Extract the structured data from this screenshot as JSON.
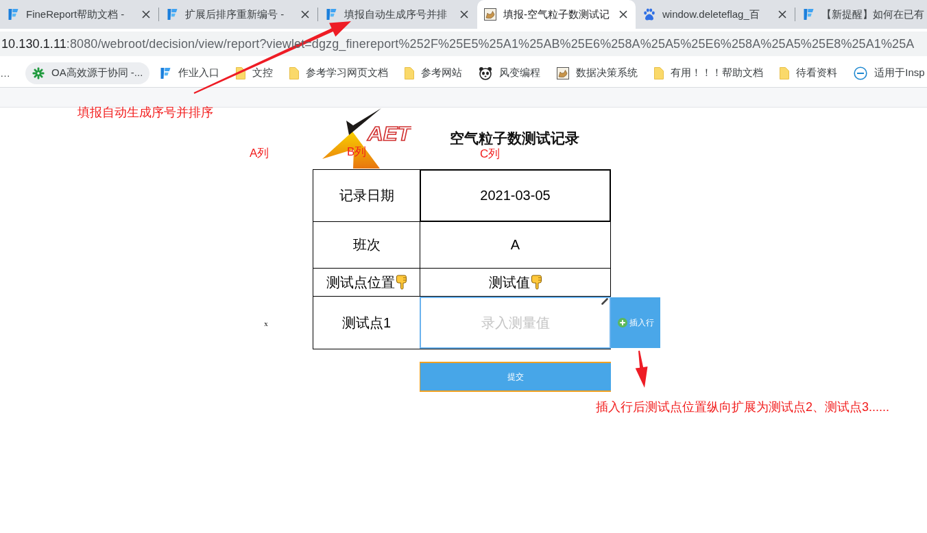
{
  "tabs": [
    {
      "title": "FineReport帮助文档 -",
      "selected": false
    },
    {
      "title": "扩展后排序重新编号 -",
      "selected": false
    },
    {
      "title": "填报自动生成序号并排",
      "selected": false
    },
    {
      "title": "填报-空气粒子数测试记",
      "selected": true
    },
    {
      "title": "window.deleteflag_百",
      "selected": false
    },
    {
      "title": "【新提醒】如何在已有",
      "selected": false
    }
  ],
  "address_bar": {
    "host": "10.130.1.11",
    "path": ":8080/webroot/decision/view/report?viewlet=dgzg_finereport%252F%25E5%25A1%25AB%25E6%258A%25A5%25E6%258A%25A5%25E8%25A1%25A"
  },
  "bookmarks": [
    {
      "label": "…",
      "kind": "text",
      "hovered": false
    },
    {
      "label": "OA高效源于协同 -...",
      "kind": "link",
      "hovered": true
    },
    {
      "label": "作业入口",
      "kind": "link",
      "hovered": false
    },
    {
      "label": "文控",
      "kind": "folder",
      "hovered": false
    },
    {
      "label": "参考学习网页文档",
      "kind": "folder",
      "hovered": false
    },
    {
      "label": "参考网站",
      "kind": "folder",
      "hovered": false
    },
    {
      "label": "风变编程",
      "kind": "link",
      "hovered": false
    },
    {
      "label": "数据决策系统",
      "kind": "link",
      "hovered": false
    },
    {
      "label": "有用！！！帮助文档",
      "kind": "folder",
      "hovered": false
    },
    {
      "label": "待看资料",
      "kind": "folder",
      "hovered": false
    },
    {
      "label": "适用于Insp",
      "kind": "link",
      "hovered": false
    }
  ],
  "report": {
    "logo_text": "AET",
    "title": "空气粒子数测试记录",
    "rows": [
      {
        "kind": "date",
        "label": "记录日期",
        "value": "2021-03-05"
      },
      {
        "kind": "text",
        "label": "班次",
        "value": "A"
      },
      {
        "kind": "header",
        "label": "测试点位置",
        "value": "测试值"
      },
      {
        "kind": "input",
        "label": "测试点1",
        "placeholder": "录入测量值",
        "marker": "x"
      }
    ],
    "insert_button": "插入行",
    "submit_button": "提交"
  },
  "annotations": {
    "notes": [
      "填报自动生成序号并排序",
      "插入行后测试点位置纵向扩展为测试点2、测试点3......"
    ],
    "column_labels": [
      "A列",
      "B列",
      "C列"
    ]
  }
}
